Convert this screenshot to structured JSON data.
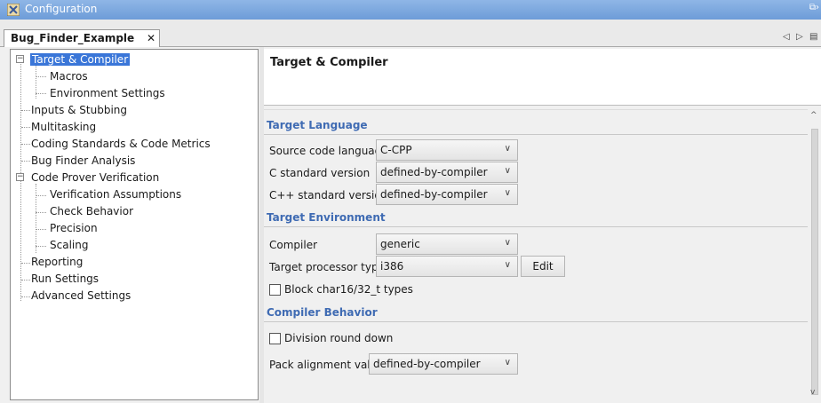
{
  "window": {
    "title": "Configuration"
  },
  "tab": {
    "label": "Bug_Finder_Example",
    "close": "✕"
  },
  "tab_nav": {
    "prev": "◁",
    "next": "▷",
    "menu": "▤"
  },
  "tree": {
    "items": [
      {
        "label": "Target & Compiler",
        "expander": "⊟"
      },
      {
        "label": "Macros"
      },
      {
        "label": "Environment Settings"
      },
      {
        "label": "Inputs & Stubbing"
      },
      {
        "label": "Multitasking"
      },
      {
        "label": "Coding Standards & Code Metrics"
      },
      {
        "label": "Bug Finder Analysis"
      },
      {
        "label": "Code Prover Verification",
        "expander": "⊟"
      },
      {
        "label": "Verification Assumptions"
      },
      {
        "label": "Check Behavior"
      },
      {
        "label": "Precision"
      },
      {
        "label": "Scaling"
      },
      {
        "label": "Reporting"
      },
      {
        "label": "Run Settings"
      },
      {
        "label": "Advanced Settings"
      }
    ]
  },
  "page": {
    "title": "Target & Compiler"
  },
  "sections": {
    "target_language": "Target Language",
    "target_environment": "Target Environment",
    "compiler_behavior": "Compiler Behavior"
  },
  "fields": {
    "source_code_language": {
      "label": "Source code language",
      "value": "C-CPP"
    },
    "c_standard_version": {
      "label": "C standard version",
      "value": "defined-by-compiler"
    },
    "cpp_standard_version": {
      "label": "C++ standard version",
      "value": "defined-by-compiler"
    },
    "compiler": {
      "label": "Compiler",
      "value": "generic"
    },
    "target_processor_type": {
      "label": "Target processor type",
      "value": "i386"
    },
    "edit_button": "Edit",
    "block_char_types": {
      "label": "Block char16/32_t types",
      "checked": false
    },
    "division_round_down": {
      "label": "Division round down",
      "checked": false
    },
    "pack_alignment_value": {
      "label": "Pack alignment value",
      "value": "defined-by-compiler"
    }
  },
  "scrollbar": {
    "up": "^",
    "down": "v"
  },
  "colors": {
    "selection": "#3a76d8",
    "section_text": "#3f6bb3",
    "titlebar": "#7aa6de"
  }
}
